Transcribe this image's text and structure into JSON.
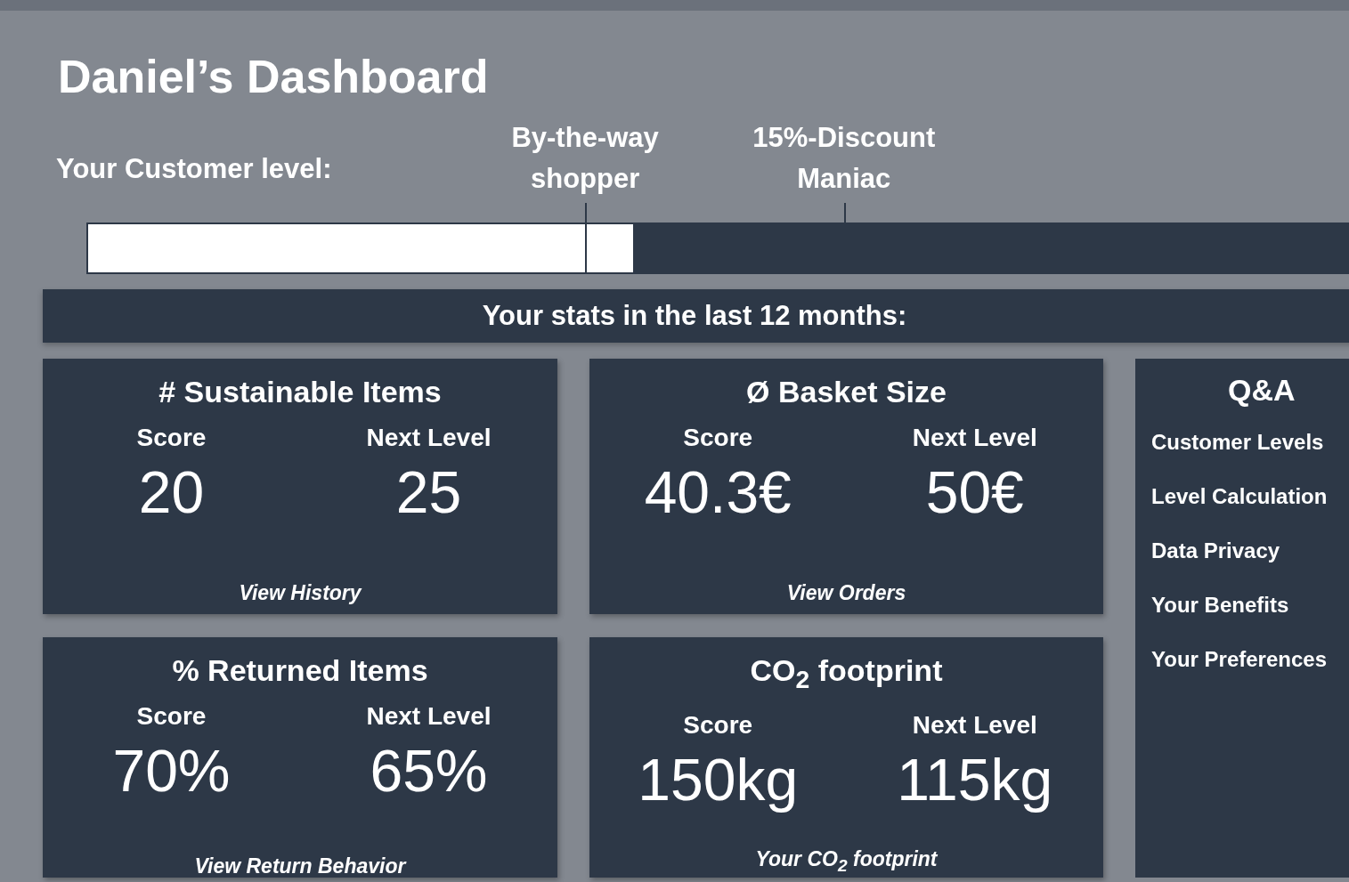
{
  "title": "Daniel’s Dashboard",
  "customer_level": {
    "label": "Your Customer level:",
    "level": 0.43,
    "milestones": [
      {
        "label": "By-the-way\nshopper"
      },
      {
        "label": "15%-Discount\nManiac"
      }
    ]
  },
  "stats_banner": "Your stats in the last 12 months:",
  "cards": [
    {
      "title": "# Sustainable Items",
      "score_label": "Score",
      "score": "20",
      "next_label": "Next Level",
      "next": "25",
      "link": "View History"
    },
    {
      "title": "Ø Basket Size",
      "score_label": "Score",
      "score": "40.3€",
      "next_label": "Next Level",
      "next": "50€",
      "link": "View Orders"
    },
    {
      "title": "% Returned Items",
      "score_label": "Score",
      "score": "70%",
      "next_label": "Next Level",
      "next": "65%",
      "link": "View Return Behavior"
    },
    {
      "title": "CO$_{2}$ footprint",
      "score_label": "Score",
      "score": "150kg",
      "next_label": "Next Level",
      "next": "115kg",
      "link": "Your CO$_{2}$ footprint"
    }
  ],
  "qa": {
    "title": "Q&A",
    "items": [
      "Customer Levels",
      "Level Calculation",
      "Data Privacy",
      "Your Benefits",
      "Your Preferences"
    ]
  }
}
